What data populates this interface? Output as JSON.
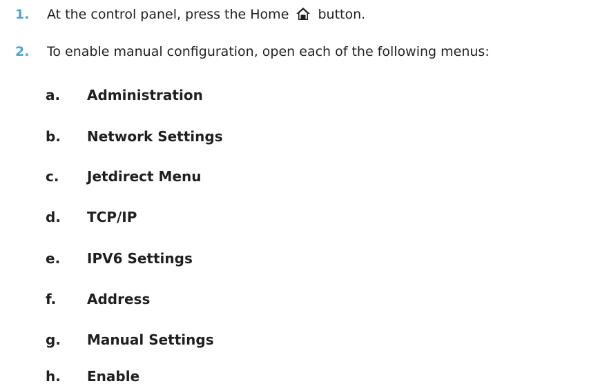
{
  "steps": [
    {
      "number": "1.",
      "text_before_icon": "At the control panel, press the Home",
      "icon": "home-icon",
      "text_after_icon": "button."
    },
    {
      "number": "2.",
      "text": "To enable manual configuration, open each of the following menus:"
    }
  ],
  "menu_path": [
    {
      "letter": "a.",
      "label": "Administration"
    },
    {
      "letter": "b.",
      "label": "Network Settings"
    },
    {
      "letter": "c.",
      "label": "Jetdirect Menu"
    },
    {
      "letter": "d.",
      "label": "TCP/IP"
    },
    {
      "letter": "e.",
      "label": "IPV6 Settings"
    },
    {
      "letter": "f.",
      "label": "Address"
    },
    {
      "letter": "g.",
      "label": "Manual Settings"
    },
    {
      "letter": "h.",
      "label": "Enable"
    }
  ],
  "colors": {
    "step_number": "#4fa3d1",
    "text": "#1f1f1f"
  }
}
